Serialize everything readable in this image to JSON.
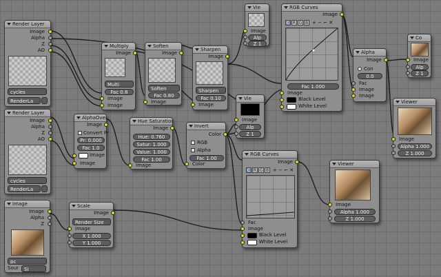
{
  "colors": {
    "background": "#7b7b7b",
    "node": "#8e8e8e",
    "header": "#b0b0b0",
    "socket_image": "#d8d828",
    "socket_value": "#9a9a9a",
    "socket_vector": "#6464c8",
    "wire": "#1e1e1e"
  },
  "render_layers_1": {
    "title": "Render Layer",
    "out_image": "Image",
    "out_alpha": "Alpha",
    "out_z": "Z",
    "out_ao": "AO",
    "scene": "cycles",
    "layer": "RenderLa"
  },
  "render_layers_2": {
    "title": "Render Layer",
    "out_image": "Image",
    "out_alpha": "Alpha",
    "out_z": "Z",
    "out_ao": "AO",
    "scene": "cycles",
    "layer": "RenderLa"
  },
  "image_node": {
    "title": "Image",
    "out_image": "Image",
    "out_alpha": "Alpha",
    "out_z": "Z",
    "source_label": "Sour",
    "source_value": "Si",
    "file_btn": "pc"
  },
  "multiply": {
    "title": "Multiply",
    "out_image": "Image",
    "mode": "Multi",
    "fac": "Fac 0.8",
    "in_image1": "Image",
    "in_image2": "Image"
  },
  "soften": {
    "title": "Soften",
    "out_image": "Image",
    "mode": "Soften",
    "fac": "Fac 0.80",
    "in_image": "Image"
  },
  "sharpen": {
    "title": "Sharpen",
    "out_image": "Image",
    "mode": "Sharpen",
    "fac": "Fac 0.10",
    "in_image": "Image"
  },
  "viewer_top": {
    "title": "Vie",
    "in_image": "Image",
    "alpha": "Alp",
    "z": "Z 1"
  },
  "rgb_curves_1": {
    "title": "RGB Curves",
    "out_image": "Image",
    "tabs": [
      "C",
      "R",
      "G",
      "B"
    ],
    "tools": "+ − ⌐ ✕",
    "fac": "Fac 1.000",
    "in_image": "Image",
    "black_level": "Black Level",
    "white_level": "White Level"
  },
  "set_alpha": {
    "title": "Alpha",
    "out_image": "Image",
    "con": "Con",
    "value": "0.0",
    "in_fac": "Fac",
    "in_image1": "Image",
    "in_image2": "Image"
  },
  "composite": {
    "title": "Co",
    "in_image": "Image",
    "alpha": "Alp",
    "z": "Z 1"
  },
  "alpha_over": {
    "title": "AlphaOver",
    "out_image": "Image",
    "convert": "Convert Pr",
    "premul": "Pr: 0.000",
    "fac": "Fac 1.0",
    "in_image1": "Image",
    "in_image2": "Image"
  },
  "hue_saturation": {
    "title": "Hue Saturation",
    "out_image": "Image",
    "hue": "Hue: 0.760",
    "sat": "Satur: 1.000",
    "value": "Value: 1.000",
    "fac": "Fac 1.00",
    "in_image": "Image"
  },
  "invert": {
    "title": "Invert",
    "out_color": "Color",
    "rgb": "RGB",
    "alpha": "Alpha",
    "fac": "Fac 1.00",
    "in_color": "Color"
  },
  "viewer_mid": {
    "title": "Vie",
    "in_image": "Image",
    "alpha": "Alp",
    "z": "Z 1"
  },
  "rgb_curves_2": {
    "title": "RGB Curves",
    "out_image": "Image",
    "tabs": [
      "C",
      "R",
      "G",
      "B"
    ],
    "tools": "+ − ⌐ ✕",
    "in_fac": "Fac",
    "in_image": "Image",
    "black_level": "Black Level",
    "white_level": "White Level"
  },
  "viewer_right": {
    "title": "Viewer",
    "in_image": "Image",
    "alpha": "Alpha 1.000",
    "z": "Z 1.000"
  },
  "viewer_bottom": {
    "title": "Viewer",
    "in_image": "Image",
    "alpha": "Alpha 1.000",
    "z": "Z 1.000"
  },
  "scale": {
    "title": "Scale",
    "out_image": "Image",
    "mode": "Render Size",
    "in_image": "Image",
    "x": "X 1.000",
    "y": "Y 1.000"
  }
}
